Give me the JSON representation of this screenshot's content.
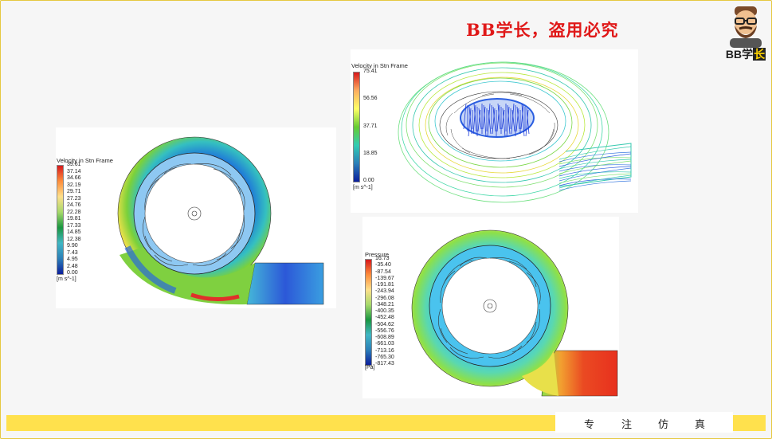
{
  "watermark": "BB学长，盗用必究",
  "avatar": {
    "text_a": "BB学",
    "text_b": "长"
  },
  "footer": {
    "chars": [
      "专",
      "注",
      "仿",
      "真"
    ]
  },
  "panels": [
    {
      "legend_title": "Velocity in Stn Frame",
      "ticks": [
        "39.61",
        "37.14",
        "34.66",
        "32.19",
        "29.71",
        "27.23",
        "24.76",
        "22.28",
        "19.81",
        "17.33",
        "14.85",
        "12.38",
        "9.90",
        "7.43",
        "4.95",
        "2.48",
        "0.00"
      ],
      "unit": "[m s^-1]",
      "gradient": [
        "#d7191c",
        "#fd8d3c",
        "#fee08b",
        "#a6d96a",
        "#1a9641",
        "#41b6c4",
        "#2c7fb8",
        "#0c1f9c"
      ]
    },
    {
      "legend_title": "Velocity in Stn Frame",
      "ticks": [
        "75.41",
        "56.56",
        "37.71",
        "18.85",
        "0.00"
      ],
      "unit": "[m s^-1]",
      "gradient": [
        "#d7191c",
        "#fdae61",
        "#ffff66",
        "#66cc33",
        "#33ccb3",
        "#2c7fb8",
        "#0c1f9c"
      ]
    },
    {
      "legend_title": "Pressure",
      "ticks": [
        "16.73",
        "-35.40",
        "-87.54",
        "-139.67",
        "-191.81",
        "-243.94",
        "-296.08",
        "-348.21",
        "-400.35",
        "-452.48",
        "-504.62",
        "-556.76",
        "-608.89",
        "-661.03",
        "-713.16",
        "-765.30",
        "-817.43"
      ],
      "unit": "[Pa]",
      "gradient": [
        "#d7191c",
        "#fd8d3c",
        "#fee08b",
        "#a6d96a",
        "#1a9641",
        "#41b6c4",
        "#2c7fb8",
        "#0c1f9c"
      ]
    }
  ]
}
